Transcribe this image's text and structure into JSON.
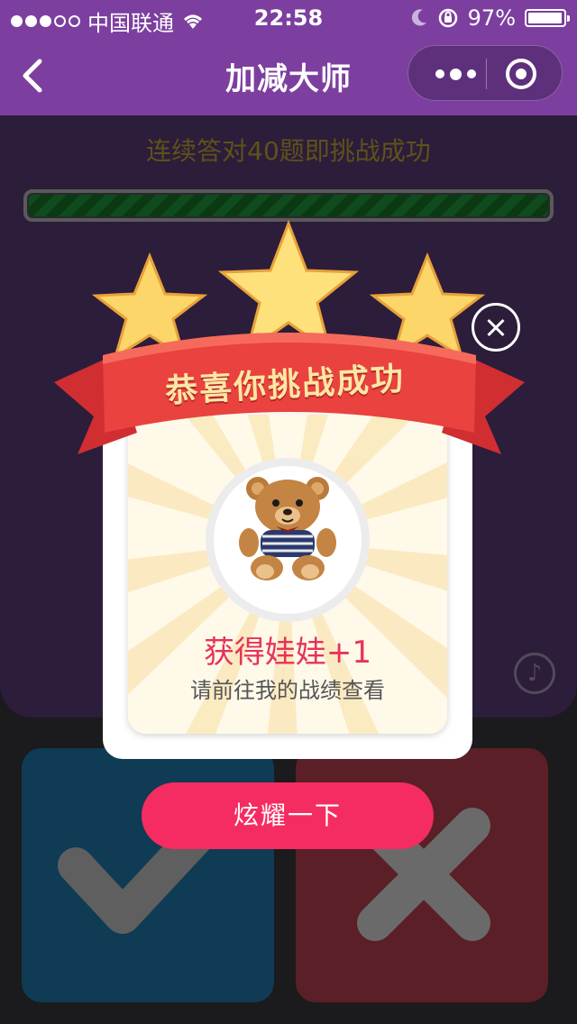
{
  "status_bar": {
    "carrier": "中国联通",
    "time": "22:58",
    "battery": "97%",
    "battery_level": 0.97,
    "signal_filled": 3,
    "signal_total": 5
  },
  "nav": {
    "title": "加减大师",
    "back_icon": "chevron-left-icon",
    "more_icon": "more-dots-icon",
    "target_icon": "target-icon"
  },
  "game": {
    "goal_text": "连续答对40题即挑战成功",
    "progress": 1.0,
    "music_icon": "music-note-icon",
    "correct_icon": "check-icon",
    "wrong_icon": "cross-icon"
  },
  "popup": {
    "banner": "恭喜你挑战成功",
    "prize_title": "获得娃娃+1",
    "prize_subtitle": "请前往我的战绩查看",
    "share_button": "炫耀一下",
    "close_icon": "close-icon",
    "stars": 3,
    "prize_image": "teddy-bear"
  },
  "colors": {
    "nav_purple": "#7c3f9f",
    "accent_pink": "#f52c61",
    "prize_red": "#e8325a",
    "ribbon_red": "#e2383b",
    "star_yellow": "#fdd66a"
  }
}
